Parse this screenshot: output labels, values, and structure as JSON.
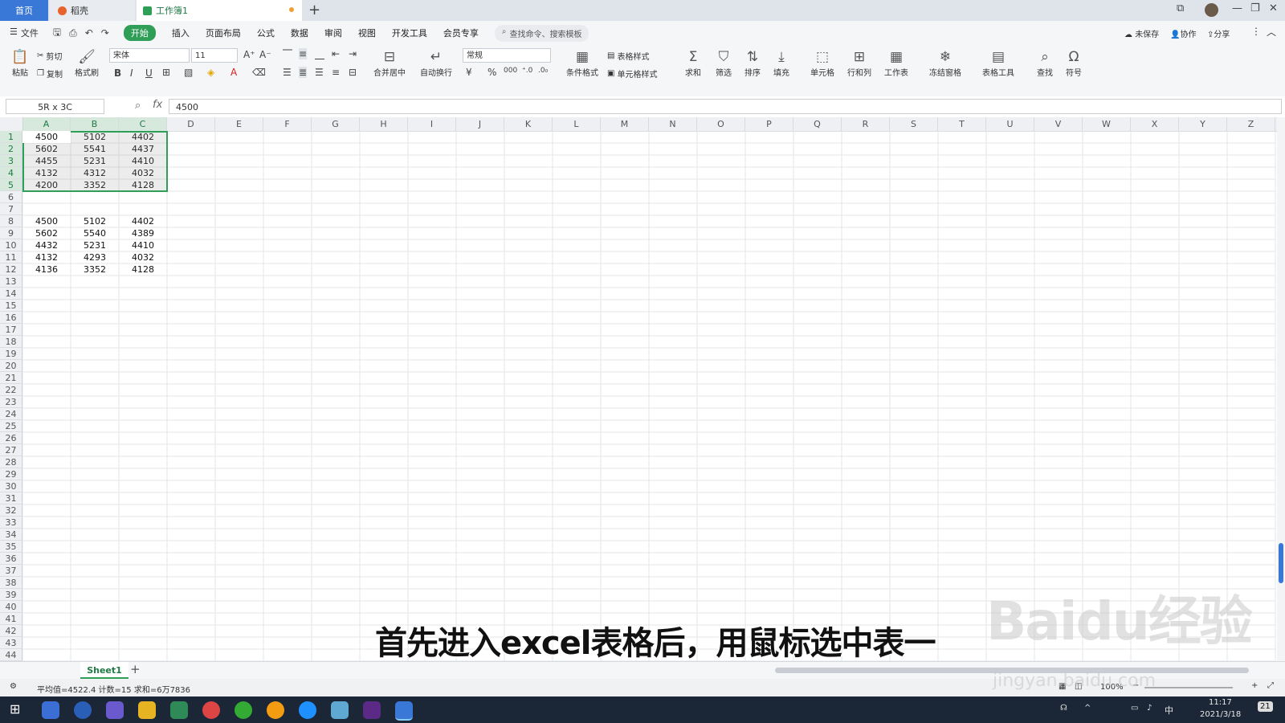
{
  "tabs": {
    "home": "首页",
    "docer": "稻壳",
    "workbook": "工作簿1"
  },
  "menu": {
    "file": "文件",
    "items": [
      "开始",
      "插入",
      "页面布局",
      "公式",
      "数据",
      "审阅",
      "视图",
      "开发工具",
      "会员专享"
    ],
    "search_placeholder": "查找命令、搜索模板",
    "unsaved": "未保存",
    "collab": "协作",
    "share": "分享"
  },
  "ribbon": {
    "paste": "粘贴",
    "cut": "剪切",
    "copy": "复制",
    "format_painter": "格式刷",
    "font": "宋体",
    "font_size": "11",
    "merge_center": "合并居中",
    "wrap": "自动换行",
    "number_format": "常规",
    "cond_format": "条件格式",
    "table_style": "表格样式",
    "cell_style": "单元格样式",
    "sum": "求和",
    "filter": "筛选",
    "sort": "排序",
    "fill": "填充",
    "cell": "单元格",
    "rowcol": "行和列",
    "sheet": "工作表",
    "freeze": "冻结窗格",
    "table_tools": "表格工具",
    "find": "查找",
    "symbol": "符号"
  },
  "formula": {
    "name_box": "5R x 3C",
    "fx": "fx",
    "value": "4500"
  },
  "columns": [
    "A",
    "B",
    "C",
    "D",
    "E",
    "F",
    "G",
    "H",
    "I",
    "J",
    "K",
    "L",
    "M",
    "N",
    "O",
    "P",
    "Q",
    "R",
    "S",
    "T",
    "U",
    "V",
    "W",
    "X",
    "Y",
    "Z"
  ],
  "row_count": 44,
  "cells": {
    "1": [
      "4500",
      "5102",
      "4402"
    ],
    "2": [
      "5602",
      "5541",
      "4437"
    ],
    "3": [
      "4455",
      "5231",
      "4410"
    ],
    "4": [
      "4132",
      "4312",
      "4032"
    ],
    "5": [
      "4200",
      "3352",
      "4128"
    ],
    "8": [
      "4500",
      "5102",
      "4402"
    ],
    "9": [
      "5602",
      "5540",
      "4389"
    ],
    "10": [
      "4432",
      "5231",
      "4410"
    ],
    "11": [
      "4132",
      "4293",
      "4032"
    ],
    "12": [
      "4136",
      "3352",
      "4128"
    ]
  },
  "sheet": {
    "name": "Sheet1"
  },
  "status": {
    "summary": "平均值=4522.4  计数=15  求和=6万7836",
    "zoom": "100%"
  },
  "taskbar": {
    "ime": "中",
    "time": "11:17",
    "date": "2021/3/18",
    "notif": "21"
  },
  "caption": "首先进入excel表格后，用鼠标选中表一",
  "watermark": {
    "logo": "Baidu经验",
    "url": "jingyan.baidu.com"
  },
  "colors": {
    "accent": "#2f9e57",
    "tab_home": "#3a78d8",
    "taskbar": "#1b2636"
  }
}
